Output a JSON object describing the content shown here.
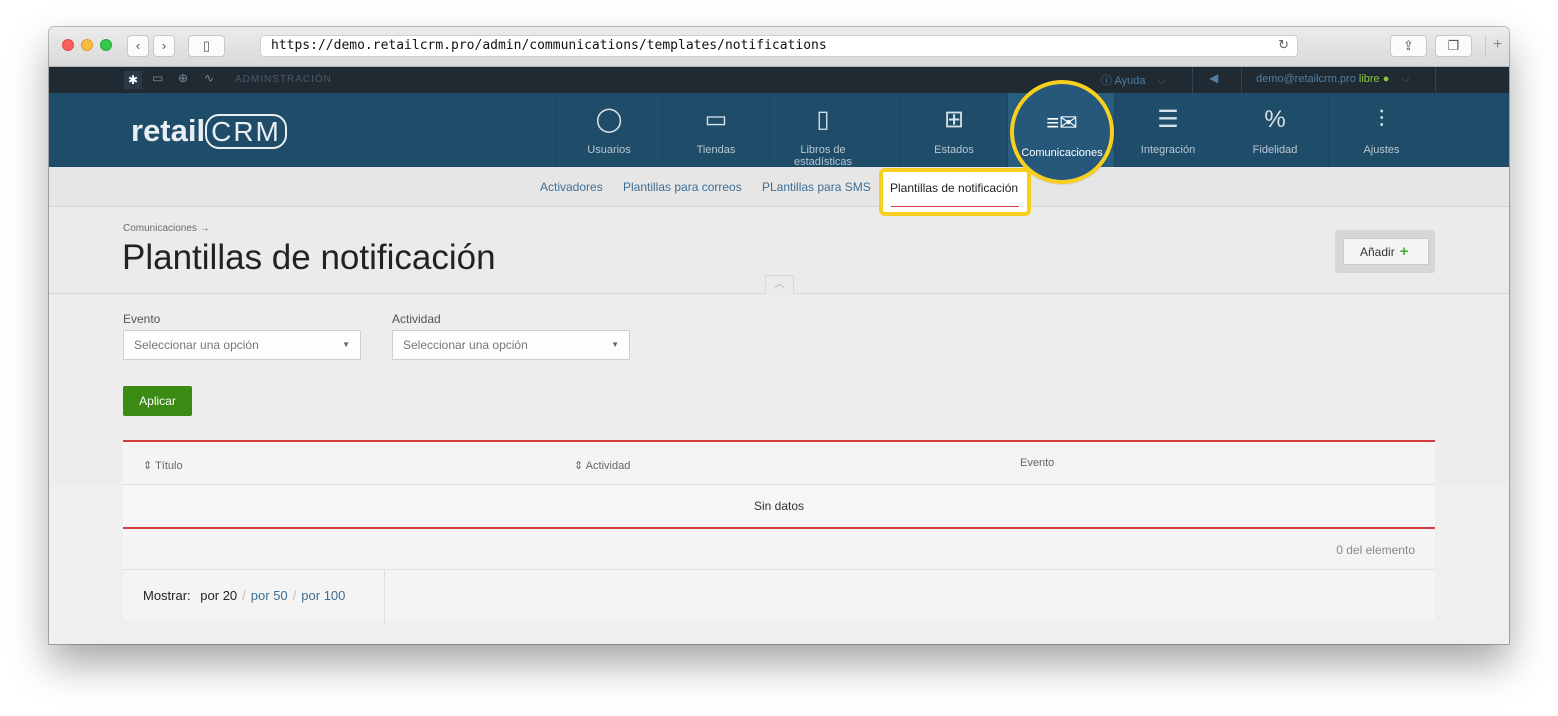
{
  "browser": {
    "url": "https://demo.retailcrm.pro/admin/communications/templates/notifications",
    "reload_icon": "reload-icon"
  },
  "topbar": {
    "admin_label": "ADMINSTRACIÓN",
    "help_label": "Ayuda",
    "user_email": "demo@retailcrm.pro",
    "user_status": "libre"
  },
  "logo": {
    "text_a": "retail",
    "text_b": "CRM"
  },
  "nav": [
    {
      "label": "Usuarios",
      "icon": "user-icon"
    },
    {
      "label": "Tiendas",
      "icon": "store-icon"
    },
    {
      "label": "Libros de estadísticas",
      "icon": "book-icon"
    },
    {
      "label": "Estados",
      "icon": "grid-icon"
    },
    {
      "label": "Comunicaciones",
      "icon": "envelope-icon",
      "active": true
    },
    {
      "label": "Integración",
      "icon": "integration-icon"
    },
    {
      "label": "Fidelidad",
      "icon": "percent-tag-icon"
    },
    {
      "label": "Ajustes",
      "icon": "sliders-icon"
    }
  ],
  "subnav": [
    {
      "label": "Activadores"
    },
    {
      "label": "Plantillas para correos"
    },
    {
      "label": "PLantillas para SMS"
    },
    {
      "label": "Plantillas de notificación",
      "active": true
    }
  ],
  "page": {
    "breadcrumb": "Comunicaciones →",
    "title": "Plantillas de notificación",
    "add_label": "Añadir"
  },
  "filters": {
    "evento_label": "Evento",
    "evento_placeholder": "Seleccionar una opción",
    "actividad_label": "Actividad",
    "actividad_placeholder": "Seleccionar una opción",
    "apply_label": "Aplicar"
  },
  "table": {
    "columns": [
      "Título",
      "Actividad",
      "Evento"
    ],
    "empty_text": "Sin datos",
    "count_text": "0 del elemento"
  },
  "pager": {
    "show_label": "Mostrar:",
    "options": [
      "por 20",
      "por 50",
      "por 100"
    ]
  },
  "colors": {
    "nav_bg": "#1f4c68",
    "highlight": "#f7cf1f",
    "accent_red": "#d23c3c",
    "apply_green": "#3a8a13"
  }
}
